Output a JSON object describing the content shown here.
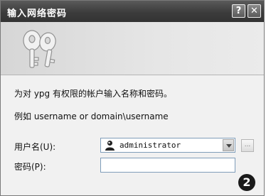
{
  "window": {
    "title": "输入网络密码",
    "help_label": "?",
    "close_label": "✕"
  },
  "banner": {
    "icon": "keys-icon"
  },
  "message": {
    "line1": "为对 ypg 有权限的帐户输入名称和密码。",
    "line2": "例如 username or domain\\username"
  },
  "form": {
    "username_label": "用户名(U):",
    "username_value": "administrator",
    "password_label": "密码(P):",
    "password_value": "",
    "browse_label": "..."
  },
  "annotation": {
    "number": "2"
  }
}
